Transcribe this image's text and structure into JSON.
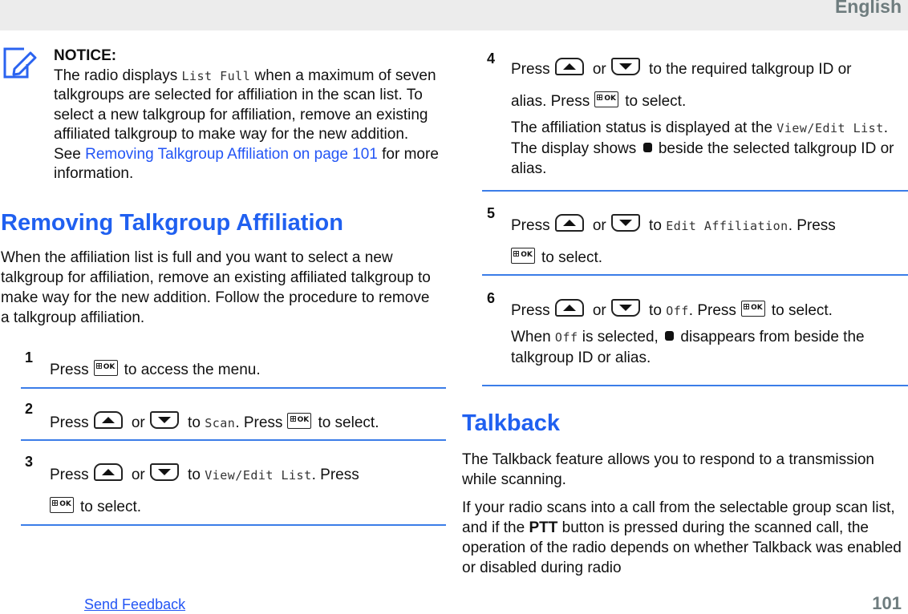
{
  "header": {
    "language": "English"
  },
  "notice": {
    "icon": "notice-pencil-icon",
    "title": "NOTICE:",
    "text_before": "The radio displays ",
    "display_text": "List Full",
    "text_after": " when a maximum of seven talkgroups are selected for affiliation in the scan list. To select a new talkgroup for affiliation, remove an existing affiliated talkgroup to make way for the new addition. See ",
    "link_text": "Removing Talkgroup Affiliation on page 101",
    "text_end": " for more information."
  },
  "section_remove": {
    "heading": "Removing Talkgroup Affiliation",
    "intro": "When the affiliation list is full and you want to select a new talkgroup for affiliation, remove an existing affiliated talkgroup to make way for the new addition. Follow the procedure to remove a talkgroup affiliation."
  },
  "steps": [
    {
      "number": "1",
      "press": "Press",
      "text": "to access the menu."
    },
    {
      "number": "2",
      "press": "Press",
      "or": "or",
      "to": "to",
      "display": "Scan",
      "press2": ". Press",
      "text": "to select."
    },
    {
      "number": "3",
      "press": "Press",
      "or": "or",
      "to": "to",
      "display": "View/Edit List",
      "press2": ". Press",
      "text": "to select."
    },
    {
      "number": "4",
      "press": "Press",
      "or": "or",
      "to": "to the required talkgroup ID or",
      "line2": "alias. Press",
      "text": "to select.",
      "note_before": "The affiliation status is displayed at the ",
      "note_display": "View/Edit List",
      "note_mid": ". The display shows ",
      "note_after": " beside the selected talkgroup ID or alias."
    },
    {
      "number": "5",
      "press": "Press",
      "or": "or",
      "to": "to",
      "display": "Edit Affiliation",
      "press2": ". Press",
      "text": "to select."
    },
    {
      "number": "6",
      "press": "Press",
      "or": "or",
      "to": "to",
      "display": "Off",
      "press2": ". Press",
      "text": "to select.",
      "note_before": "When ",
      "note_display": "Off",
      "note_mid": " is selected, ",
      "note_after": " disappears from beside the talkgroup ID or alias."
    }
  ],
  "section_talkback": {
    "heading": "Talkback",
    "p1": "The Talkback feature allows you to respond to a transmission while scanning.",
    "p2_before": "If your radio scans into a call from the selectable group scan list, and if the ",
    "p2_bold": "PTT",
    "p2_after": " button is pressed during the scanned call, the operation of the radio depends on whether Talkback was enabled or disabled during radio"
  },
  "footer": {
    "feedback_link": "Send Feedback",
    "page_number": "101"
  },
  "colors": {
    "accent": "#2060f0",
    "link": "#2355f5",
    "rule": "#3b7de8",
    "header_bg": "#ececec",
    "muted": "#6e7c7e"
  }
}
